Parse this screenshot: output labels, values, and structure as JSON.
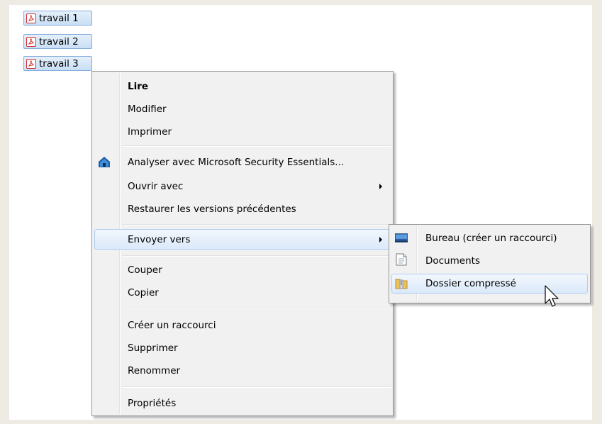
{
  "files": [
    {
      "label": "travail 1"
    },
    {
      "label": "travail 2"
    },
    {
      "label": "travail 3"
    }
  ],
  "context_menu": {
    "items": [
      {
        "label": "Lire",
        "bold": true
      },
      {
        "label": "Modifier"
      },
      {
        "label": "Imprimer"
      },
      {
        "label": "Analyser avec Microsoft Security Essentials...",
        "icon": "security-essentials-icon"
      },
      {
        "label": "Ouvrir avec",
        "has_submenu": true
      },
      {
        "label": "Restaurer les versions précédentes"
      },
      {
        "label": "Envoyer vers",
        "has_submenu": true,
        "highlighted": true
      },
      {
        "label": "Couper"
      },
      {
        "label": "Copier"
      },
      {
        "label": "Créer un raccourci"
      },
      {
        "label": "Supprimer"
      },
      {
        "label": "Renommer"
      },
      {
        "label": "Propriétés"
      }
    ]
  },
  "send_to_submenu": {
    "items": [
      {
        "label": "Bureau (créer un raccourci)",
        "icon": "desktop-icon"
      },
      {
        "label": "Documents",
        "icon": "document-icon"
      },
      {
        "label": "Dossier compressé",
        "icon": "zip-folder-icon",
        "highlighted": true
      }
    ]
  },
  "colors": {
    "selection_border": "#84acdd",
    "highlight_border": "#aeccf1",
    "menu_background": "#f1f1f1"
  }
}
